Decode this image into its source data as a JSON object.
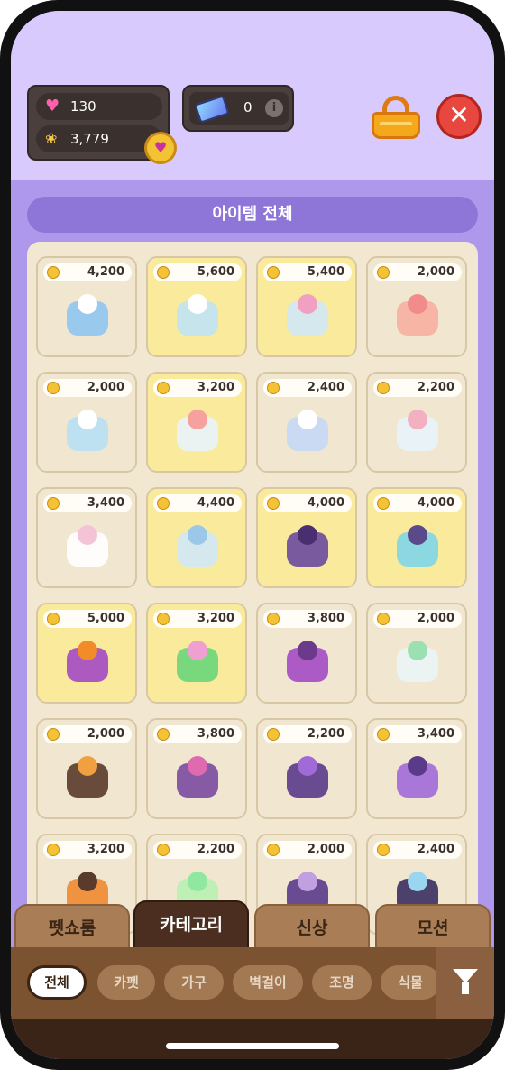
{
  "currency": {
    "hearts": "130",
    "paws": "3,779",
    "tickets": "0"
  },
  "icons": {
    "heart": "heart-icon",
    "paw": "paw-icon",
    "ticket": "ticket-icon",
    "info": "info-icon",
    "basket": "basket-icon",
    "close": "close-icon",
    "coin": "coin-icon",
    "filter": "filter-icon"
  },
  "header": {
    "title": "아이템 전체"
  },
  "items": [
    {
      "price": "4,200",
      "highlight": false
    },
    {
      "price": "5,600",
      "highlight": true
    },
    {
      "price": "5,400",
      "highlight": true
    },
    {
      "price": "2,000",
      "highlight": false
    },
    {
      "price": "2,000",
      "highlight": false
    },
    {
      "price": "3,200",
      "highlight": true
    },
    {
      "price": "2,400",
      "highlight": false
    },
    {
      "price": "2,200",
      "highlight": false
    },
    {
      "price": "3,400",
      "highlight": false
    },
    {
      "price": "4,400",
      "highlight": true
    },
    {
      "price": "4,000",
      "highlight": true
    },
    {
      "price": "4,000",
      "highlight": true
    },
    {
      "price": "5,000",
      "highlight": true
    },
    {
      "price": "3,200",
      "highlight": true
    },
    {
      "price": "3,800",
      "highlight": false
    },
    {
      "price": "2,000",
      "highlight": false
    },
    {
      "price": "2,000",
      "highlight": false
    },
    {
      "price": "3,800",
      "highlight": false
    },
    {
      "price": "2,200",
      "highlight": false
    },
    {
      "price": "3,400",
      "highlight": false
    },
    {
      "price": "3,200",
      "highlight": false
    },
    {
      "price": "2,200",
      "highlight": false
    },
    {
      "price": "2,000",
      "highlight": false
    },
    {
      "price": "2,400",
      "highlight": false
    }
  ],
  "tabs": [
    {
      "label": "펫쇼룸",
      "active": false
    },
    {
      "label": "카테고리",
      "active": true
    },
    {
      "label": "신상",
      "active": false
    },
    {
      "label": "모션",
      "active": false
    }
  ],
  "filters": [
    {
      "label": "전체",
      "active": true
    },
    {
      "label": "카펫",
      "active": false
    },
    {
      "label": "가구",
      "active": false
    },
    {
      "label": "벽걸이",
      "active": false
    },
    {
      "label": "조명",
      "active": false
    },
    {
      "label": "식물",
      "active": false
    }
  ],
  "colors": {
    "top_background": "#d8cafc",
    "main_background": "#ad98ec",
    "header_pill": "#8e76d8",
    "card_highlight": "#faeb9c",
    "card_normal": "#f1e7d1",
    "tab_active": "#4b2e1f",
    "tab_inactive": "#a97d56"
  }
}
